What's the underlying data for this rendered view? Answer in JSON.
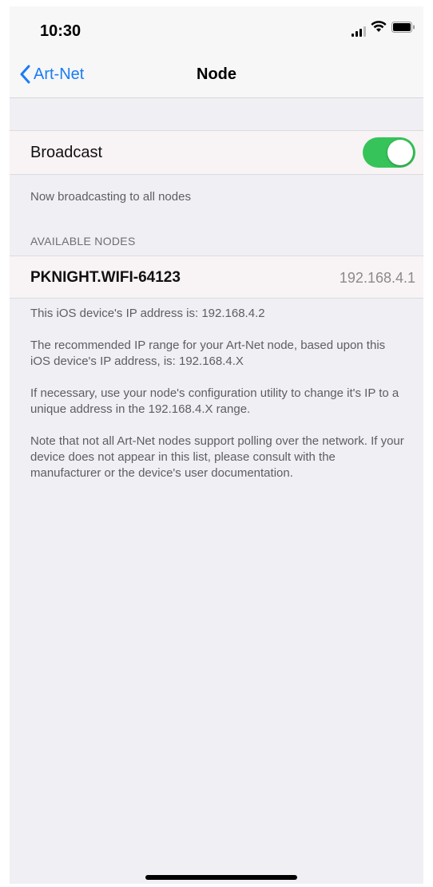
{
  "status_bar": {
    "time": "10:30"
  },
  "nav": {
    "back_label": "Art-Net",
    "title": "Node"
  },
  "broadcast": {
    "label": "Broadcast",
    "enabled": true,
    "footer": "Now broadcasting to all nodes"
  },
  "nodes": {
    "header": "AVAILABLE NODES",
    "items": [
      {
        "name": "PKNIGHT.WIFI-64123",
        "ip": "192.168.4.1"
      }
    ]
  },
  "info": {
    "device_ip": "This iOS device's IP address is: 192.168.4.2",
    "recommended_range": "The recommended IP range for your Art-Net node, based upon this iOS device's IP address, is: 192.168.4.X",
    "change_ip": "If necessary, use your node's configuration utility to change it's IP to a unique address in the 192.168.4.X range.",
    "polling_note": "Note that not all Art-Net nodes support polling over the network. If your device does not appear in this list, please consult with the manufacturer or the device's user documentation."
  },
  "colors": {
    "accent": "#1a7cf5",
    "toggle_on": "#36c45a",
    "background": "#efeff4"
  }
}
